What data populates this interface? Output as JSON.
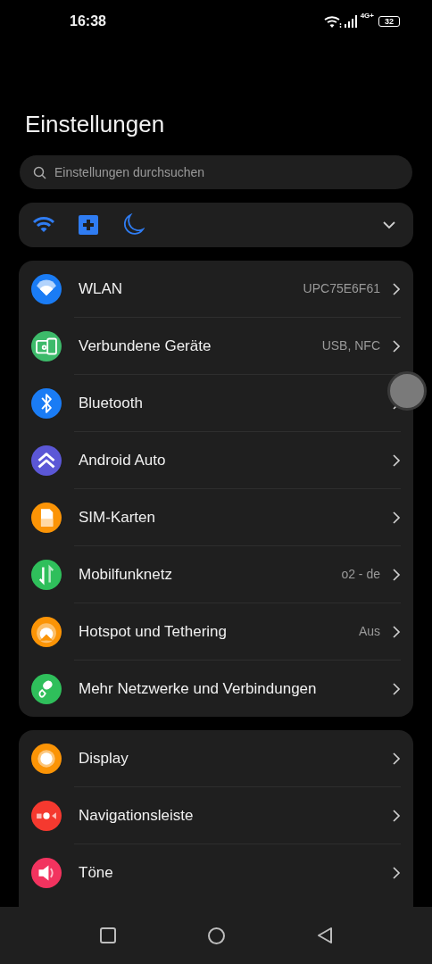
{
  "status_bar": {
    "time": "16:38",
    "network": "4G+",
    "battery": "32"
  },
  "title": "Einstellungen",
  "search": {
    "placeholder": "Einstellungen durchsuchen"
  },
  "sections": [
    {
      "items": [
        {
          "label": "WLAN",
          "value": "UPC75E6F61",
          "color": "#1a7cf5"
        },
        {
          "label": "Verbundene Geräte",
          "value": "USB, NFC",
          "color": "#3dba6a"
        },
        {
          "label": "Bluetooth",
          "color": "#1a7cf5"
        },
        {
          "label": "Android Auto",
          "color": "#5b57d6"
        },
        {
          "label": "SIM-Karten",
          "color": "#fb9406"
        },
        {
          "label": "Mobilfunknetz",
          "value": "o2 - de",
          "color": "#2fbf5b"
        },
        {
          "label": "Hotspot und Tethering",
          "value": "Aus",
          "color": "#fb9406"
        },
        {
          "label": "Mehr Netzwerke und Verbindungen",
          "color": "#2fbf5b"
        }
      ]
    },
    {
      "items": [
        {
          "label": "Display",
          "color": "#fb9406"
        },
        {
          "label": "Navigationsleiste",
          "color": "#f5392f"
        },
        {
          "label": "Töne",
          "color": "#f2335f"
        }
      ]
    }
  ]
}
